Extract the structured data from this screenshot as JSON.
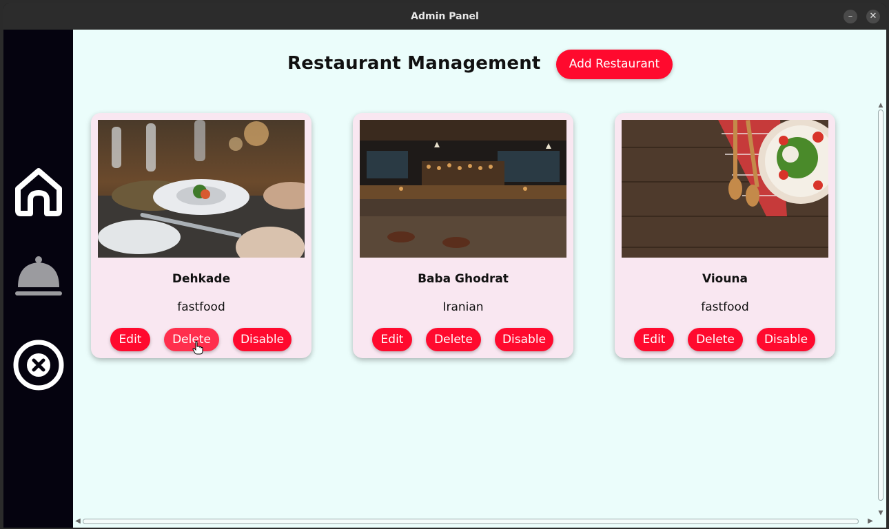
{
  "window": {
    "title": "Admin Panel",
    "minimize_label": "–",
    "close_label": "✕"
  },
  "sidebar": {
    "items": [
      {
        "name": "home",
        "icon": "home-icon"
      },
      {
        "name": "restaurants",
        "icon": "cloche-icon"
      },
      {
        "name": "exit",
        "icon": "close-circle-icon"
      }
    ]
  },
  "header": {
    "title": "Restaurant Management",
    "add_button_label": "Add Restaurant"
  },
  "restaurants": [
    {
      "name": "Dehkade",
      "cuisine": "fastfood",
      "edit_label": "Edit",
      "delete_label": "Delete",
      "disable_label": "Disable",
      "image": "restaurant-dining-photo"
    },
    {
      "name": "Baba Ghodrat",
      "cuisine": "Iranian",
      "edit_label": "Edit",
      "delete_label": "Delete",
      "disable_label": "Disable",
      "image": "bar-interior-photo"
    },
    {
      "name": "Viouna",
      "cuisine": "fastfood",
      "edit_label": "Edit",
      "delete_label": "Delete",
      "disable_label": "Disable",
      "image": "salad-on-wood-photo"
    }
  ],
  "colors": {
    "accent": "#ff0a2e",
    "content_bg": "#ebfdfb",
    "card_bg": "#f9e7f1",
    "sidebar_bg": "#05030f"
  }
}
